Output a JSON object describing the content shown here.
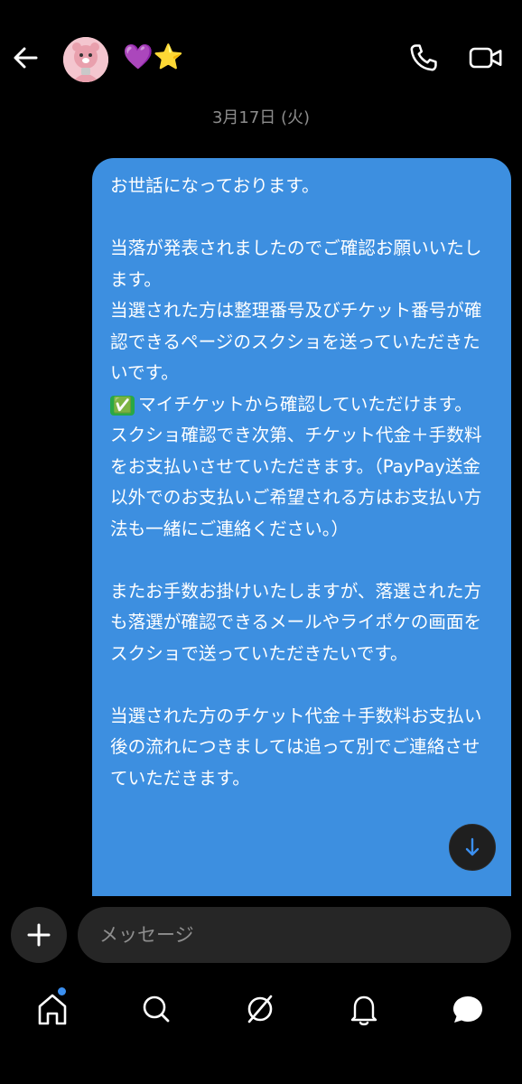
{
  "header": {
    "display_name": "💜⭐",
    "icons": {
      "back": "arrow-left-icon",
      "call": "phone-icon",
      "video": "video-camera-icon"
    }
  },
  "conversation": {
    "date_label": "3月17日 (火)",
    "message": {
      "p1": "お世話になっております。",
      "p2": "当落が発表されましたのでご確認お願いいたします。\n当選された方は整理番号及びチケット番号が確認できるページのスクショを送っていただきたいです。",
      "check_emoji": "✅",
      "p3": "マイチケットから確認していただけます。\nスクショ確認でき次第、チケット代金＋手数料をお支払いさせていただきます。（PayPay送金以外でのお支払いご希望される方はお支払い方法も一緒にご連絡ください。）",
      "p4": "またお手数お掛けいたしますが、落選された方も落選が確認できるメールやライポケの画面をスクショで送っていただきたいです。",
      "p5": "当選された方のチケット代金＋手数料お支払い後の流れにつきましては追って別でご連絡させていただきます。"
    },
    "bubble_color": "#3d8fe0"
  },
  "composer": {
    "placeholder": "メッセージ",
    "plus_icon": "plus-icon"
  },
  "bottom_nav": {
    "items": [
      "home-icon",
      "search-icon",
      "explore-icon",
      "notifications-bell-icon",
      "messages-icon"
    ],
    "home_badge_color": "#3b8ff0"
  }
}
